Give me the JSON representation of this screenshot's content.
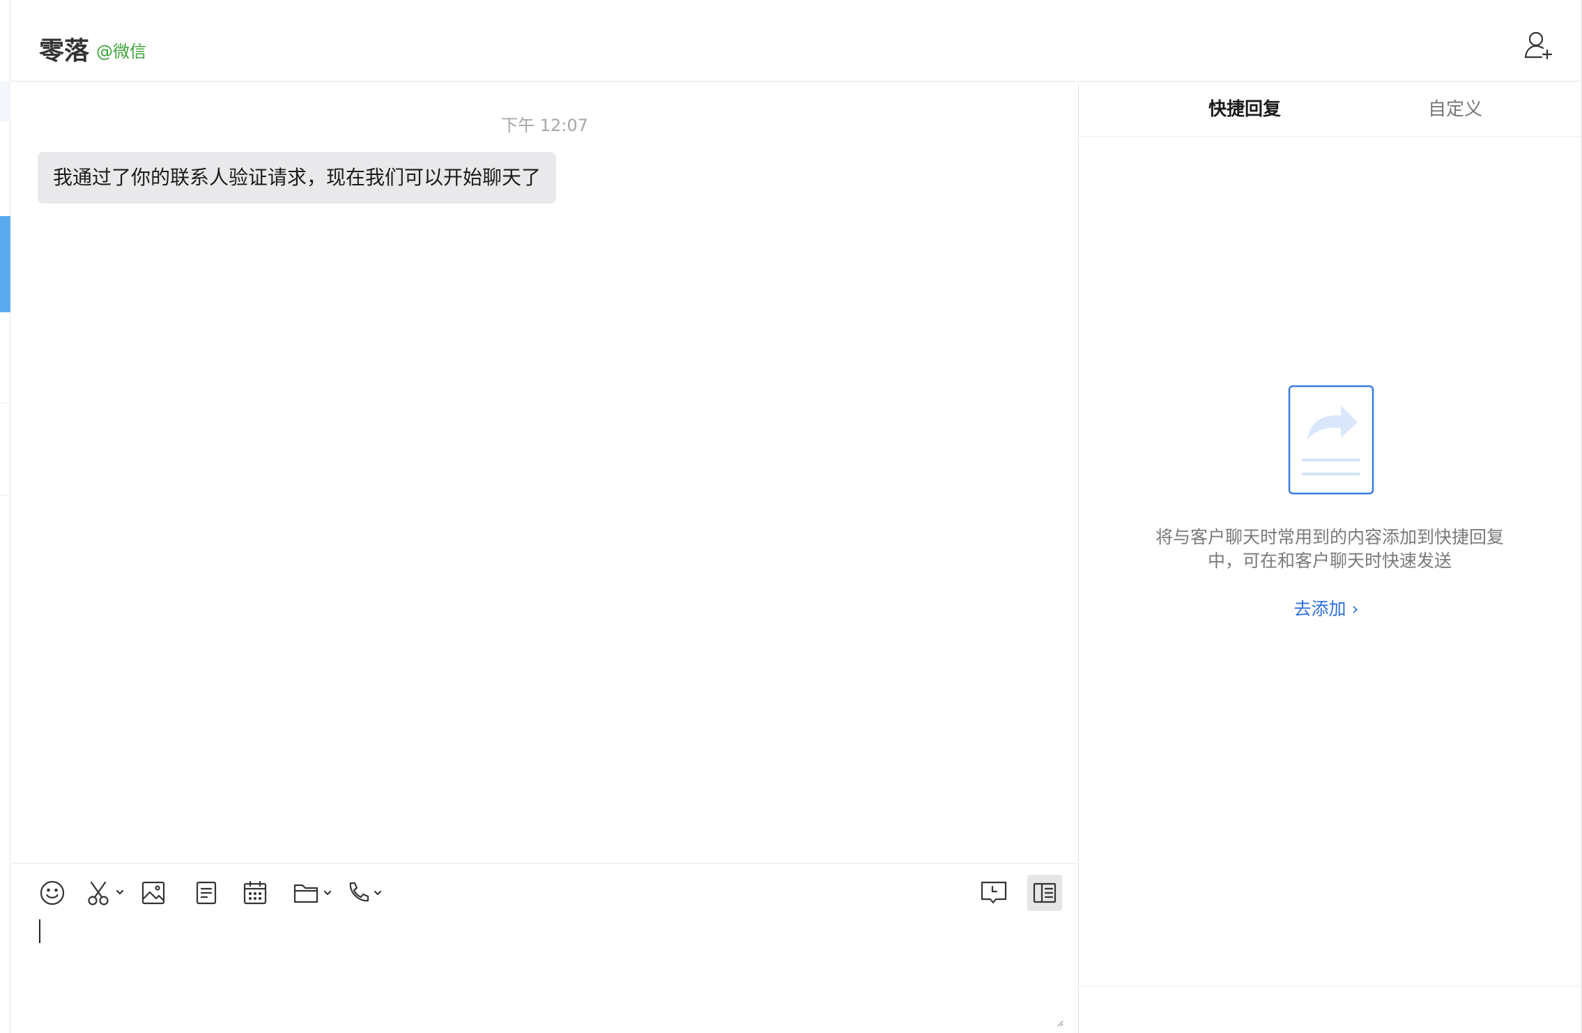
{
  "header": {
    "contact_name": "零落",
    "contact_source": "@微信"
  },
  "chat": {
    "timestamp": "下午 12:07",
    "messages": [
      {
        "sender": "contact",
        "text": "我通过了你的联系人验证请求，现在我们可以开始聊天了"
      }
    ]
  },
  "composer": {
    "value": "",
    "tools": [
      "emoji-icon",
      "screenshot-icon",
      "image-icon",
      "document-icon",
      "calendar-icon",
      "folder-icon",
      "phone-icon",
      "chat-history-icon",
      "side-panel-toggle-icon"
    ]
  },
  "side_panel": {
    "tabs": [
      {
        "label": "快捷回复",
        "active": true
      },
      {
        "label": "自定义",
        "active": false
      }
    ],
    "empty_text": "将与客户聊天时常用到的内容添加到快捷回复中，可在和客户聊天时快速发送",
    "add_link": "去添加 ›"
  },
  "colors": {
    "source_green": "#3ca236",
    "link_blue": "#2f6fdc",
    "selection_blue": "#5aaaf0",
    "bubble_gray": "#e9e9eb"
  }
}
